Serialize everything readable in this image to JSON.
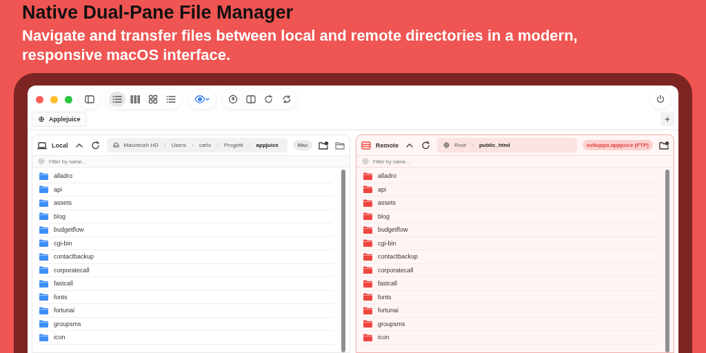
{
  "headline": "Native Dual-Pane File Manager",
  "subtitle": "Navigate and transfer files between local and remote directories in a modern, responsive macOS interface.",
  "view_modes": [
    {
      "kind": "list",
      "selected": true
    },
    {
      "kind": "grid-small",
      "selected": false
    },
    {
      "kind": "grid-large",
      "selected": false
    },
    {
      "kind": "bullets",
      "selected": false
    }
  ],
  "tabs": [
    {
      "label": "Applejuice",
      "selected": true
    }
  ],
  "panes": [
    {
      "kind": "local",
      "title": "Local",
      "path": [
        {
          "label": "Macintosh HD",
          "current": false
        },
        {
          "label": "Users",
          "current": false
        },
        {
          "label": "carlo",
          "current": false
        },
        {
          "label": "Progetti",
          "current": false
        },
        {
          "label": "appjuice",
          "current": true
        }
      ],
      "badge": "Mac",
      "filter_placeholder": "Filter by name...",
      "items": [
        "alladro",
        "api",
        "assets",
        "blog",
        "budgetflow",
        "cgi-bin",
        "contactbackup",
        "corporatecall",
        "fastcall",
        "fonts",
        "fortunai",
        "groupsms",
        "icon"
      ]
    },
    {
      "kind": "remote",
      "title": "Remote",
      "path": [
        {
          "label": "Root",
          "current": false
        },
        {
          "label": "public_html",
          "current": true
        }
      ],
      "badge": "sviluppo,appjuice (FTP)",
      "filter_placeholder": "Filter by name...",
      "items": [
        "alladro",
        "api",
        "assets",
        "blog",
        "budgetflow",
        "cgi-bin",
        "contactbackup",
        "corporatecall",
        "fastcall",
        "fonts",
        "fortunai",
        "groupsms",
        "icon"
      ]
    }
  ]
}
